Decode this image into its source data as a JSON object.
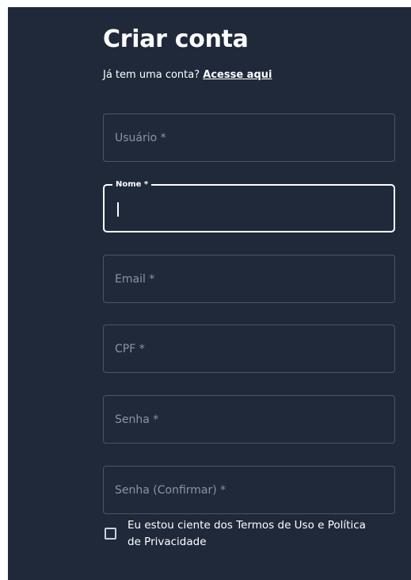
{
  "header": {
    "title": "Criar conta",
    "subtitle_prefix": "Já tem uma conta?",
    "login_link": "Acesse aqui"
  },
  "form": {
    "fields": [
      {
        "placeholder": "Usuário *",
        "focused": false
      },
      {
        "label": "Nome *",
        "value": "",
        "focused": true
      },
      {
        "placeholder": "Email *",
        "focused": false
      },
      {
        "placeholder": "CPF *",
        "focused": false
      },
      {
        "placeholder": "Senha *",
        "focused": false
      },
      {
        "placeholder": "Senha (Confirmar) *",
        "focused": false
      }
    ],
    "terms": {
      "label": "Eu estou ciente dos Termos de Uso e Política de Privacidade",
      "checked": false
    }
  },
  "colors": {
    "background": "#1f293a",
    "border": "#4a5568",
    "focus_border": "#ffffff",
    "placeholder": "#8a94a6",
    "text": "#ffffff"
  }
}
